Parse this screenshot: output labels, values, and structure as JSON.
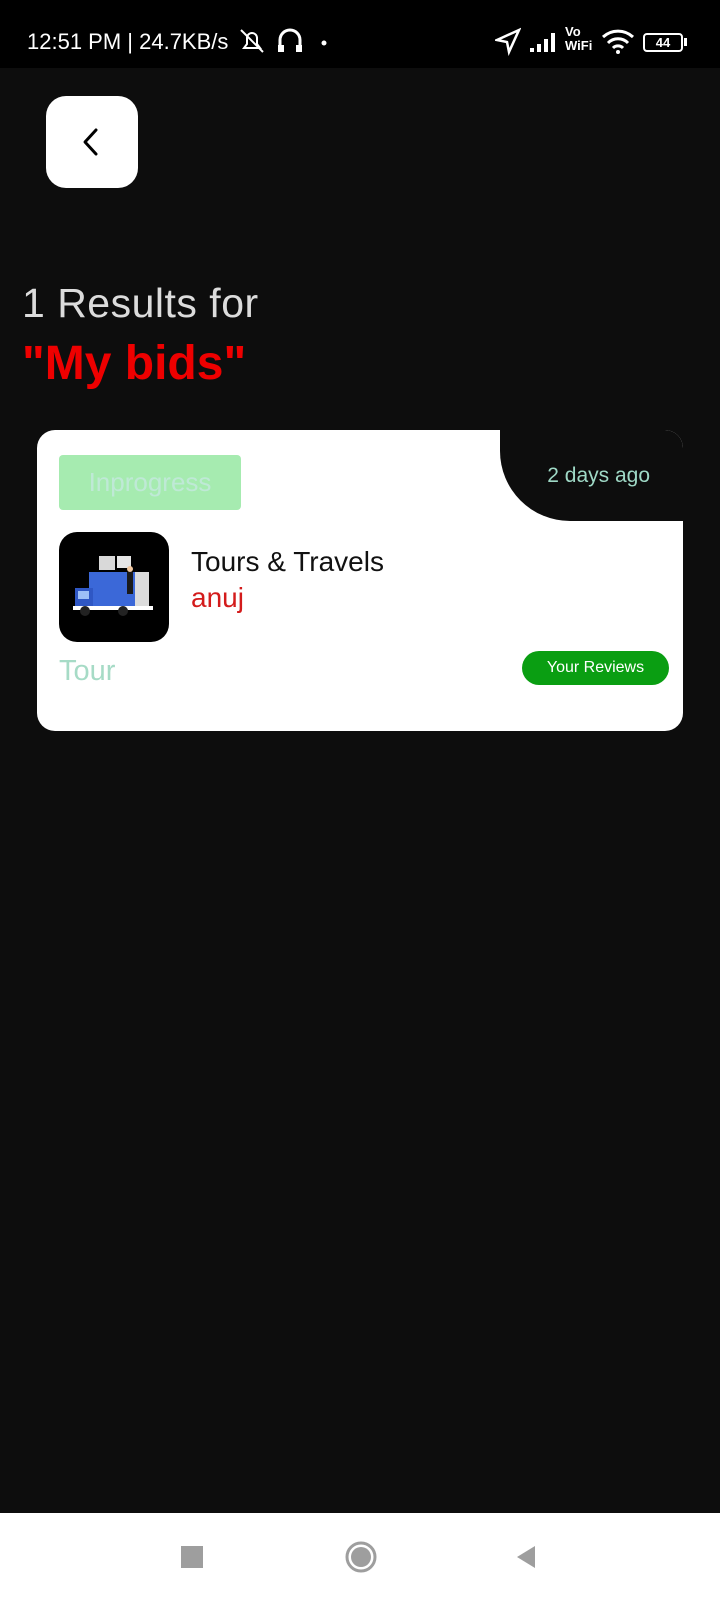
{
  "status_bar": {
    "time": "12:51 PM | 24.7KB/s",
    "battery": "44",
    "vowifi": "Vo WiFi"
  },
  "header": {
    "results_line": "1 Results for",
    "query_line": "\"My bids\""
  },
  "card": {
    "status": "Inprogress",
    "time_ago": "2 days ago",
    "title": "Tours & Travels",
    "user": "anuj",
    "category": "Tour",
    "review_button": "Your Reviews"
  },
  "icons": {
    "back": "chevron-left-icon",
    "nav_recent": "square-icon",
    "nav_home": "circle-icon",
    "nav_back": "triangle-back-icon"
  }
}
